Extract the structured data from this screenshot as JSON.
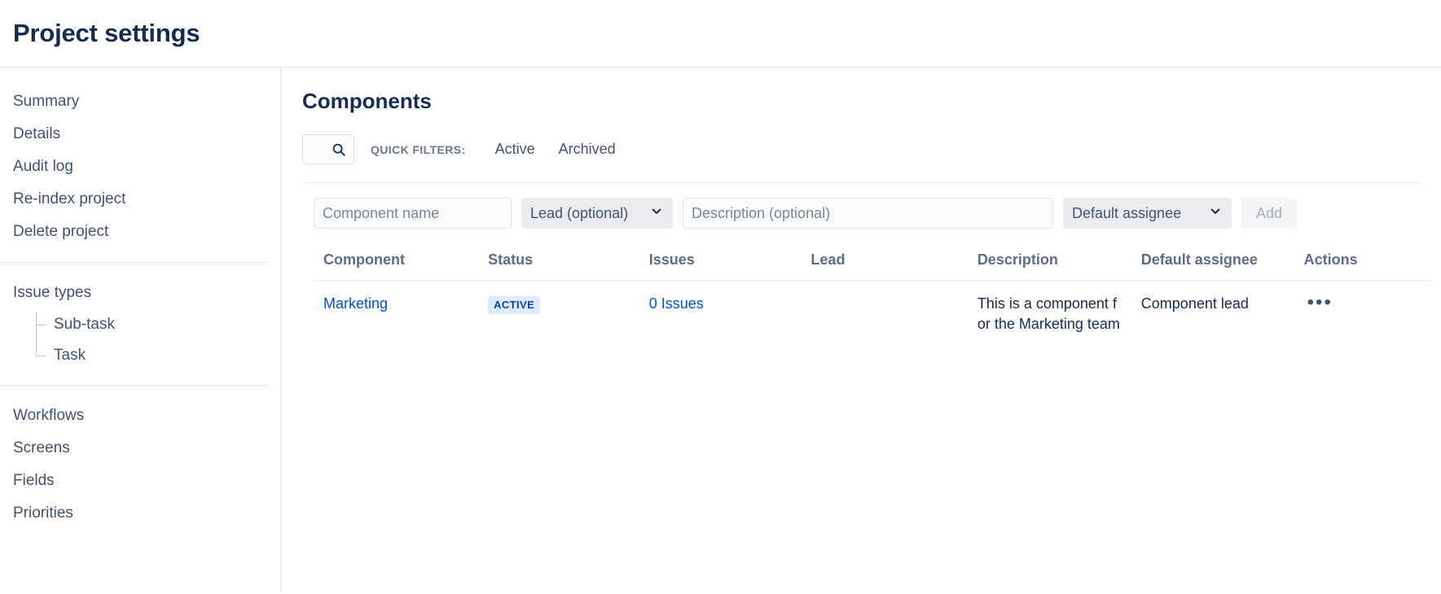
{
  "header": {
    "title": "Project settings"
  },
  "sidebar": {
    "groups": [
      {
        "items": [
          {
            "label": "Summary",
            "name": "summary"
          },
          {
            "label": "Details",
            "name": "details"
          },
          {
            "label": "Audit log",
            "name": "audit-log"
          },
          {
            "label": "Re-index project",
            "name": "re-index-project"
          },
          {
            "label": "Delete project",
            "name": "delete-project"
          }
        ]
      },
      {
        "items": [
          {
            "label": "Issue types",
            "name": "issue-types"
          }
        ],
        "subitems": [
          {
            "label": "Sub-task",
            "name": "sub-task"
          },
          {
            "label": "Task",
            "name": "task"
          }
        ]
      },
      {
        "items": [
          {
            "label": "Workflows",
            "name": "workflows"
          },
          {
            "label": "Screens",
            "name": "screens"
          },
          {
            "label": "Fields",
            "name": "fields"
          },
          {
            "label": "Priorities",
            "name": "priorities"
          }
        ]
      }
    ]
  },
  "main": {
    "title": "Components",
    "filters": {
      "search_placeholder": "",
      "search_icon": "search-icon",
      "quick_filters_label": "QUICK FILTERS:",
      "links": [
        {
          "label": "Active",
          "name": "active"
        },
        {
          "label": "Archived",
          "name": "archived"
        }
      ]
    },
    "add_form": {
      "name_placeholder": "Component name",
      "name_value": "",
      "lead_selected": "Lead (optional)",
      "lead_options": [
        "Lead (optional)"
      ],
      "description_placeholder": "Description (optional)",
      "description_value": "",
      "assignee_selected": "Default assignee",
      "assignee_options": [
        "Default assignee"
      ],
      "add_label": "Add"
    },
    "table": {
      "headers": [
        "Component",
        "Status",
        "Issues",
        "Lead",
        "Description",
        "Default assignee",
        "Actions"
      ],
      "rows": [
        {
          "component": "Marketing",
          "status": "ACTIVE",
          "issues": "0 Issues",
          "lead": "",
          "description": "This is a component for the Marketing team",
          "assignee": "Component lead",
          "actions": "•••"
        }
      ]
    }
  },
  "colors": {
    "accent_link": "#0052CC",
    "heading": "#172B4D",
    "text": "#42526E",
    "badge_bg": "#DEEBFF",
    "badge_text": "#0747A6",
    "border": "#dfe1e6"
  }
}
